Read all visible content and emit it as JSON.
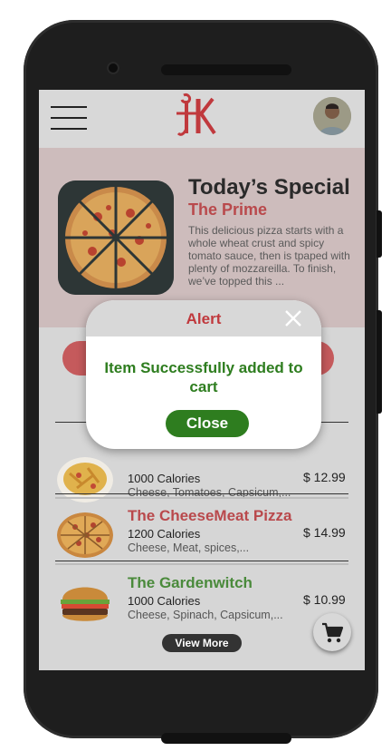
{
  "header": {
    "menu_icon": "hamburger-menu-icon",
    "logo_icon": "brand-logo",
    "avatar_icon": "user-avatar"
  },
  "special": {
    "title": "Today’s Special",
    "name": "The Prime",
    "description": "This delicious pizza starts with a whole wheat crust and spicy tomato sauce, then is tpaped with plenty of mozzareilla. To finish, we’ve topped this ..."
  },
  "menu_items": [
    {
      "name": "",
      "calories": "1000 Calories",
      "ingredients": "Cheese, Tomatoes, Capsicum,...",
      "price": "$ 12.99",
      "name_color": "#b9494c"
    },
    {
      "name": "The CheeseMeat Pizza",
      "calories": "1200 Calories",
      "ingredients": "Cheese, Meat, spices,...",
      "price": "$ 14.99",
      "name_color": "#b9494c"
    },
    {
      "name": "The Gardenwitch",
      "calories": "1000 Calories",
      "ingredients": "Cheese, Spinach, Capsicum,...",
      "price": "$ 10.99",
      "name_color": "#4a8a3b"
    }
  ],
  "view_more_label": "View More",
  "cart_icon": "cart-icon",
  "alert": {
    "title": "Alert",
    "message": "Item Successfully added to cart",
    "close_label": "Close",
    "close_icon": "close-icon"
  },
  "colors": {
    "brand_red": "#c0393d",
    "success_green": "#2e7d1f",
    "special_bg": "#cdbcbc"
  }
}
